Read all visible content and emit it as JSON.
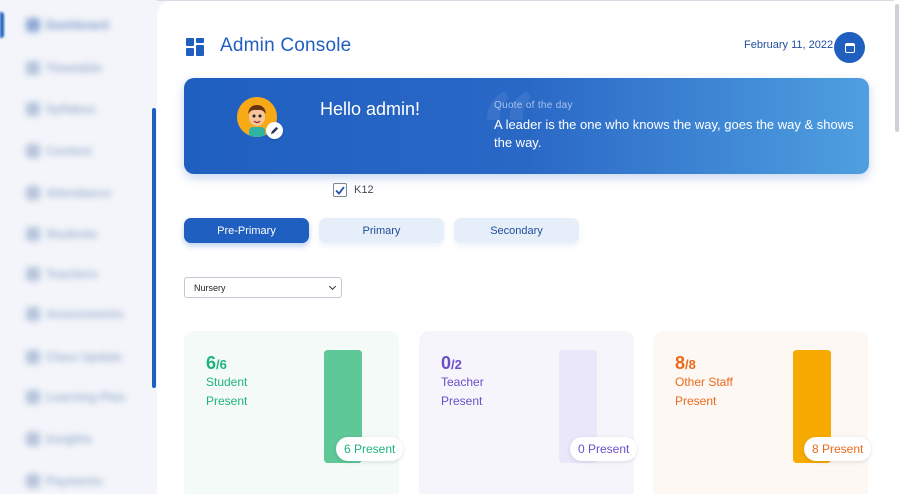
{
  "sidebar": {
    "items": [
      {
        "label": "Dashboard",
        "icon": "dashboard-icon"
      },
      {
        "label": "Timetable",
        "icon": "timetable-icon"
      },
      {
        "label": "Syllabus",
        "icon": "syllabus-icon"
      },
      {
        "label": "Content",
        "icon": "content-icon"
      },
      {
        "label": "Attendance",
        "icon": "attendance-icon"
      },
      {
        "label": "Students",
        "icon": "students-icon"
      },
      {
        "label": "Teachers",
        "icon": "teachers-icon"
      },
      {
        "label": "Assessments",
        "icon": "assessments-icon"
      },
      {
        "label": "Class Update",
        "icon": "class-update-icon"
      },
      {
        "label": "Learning Plan",
        "icon": "learning-plan-icon"
      },
      {
        "label": "Insights",
        "icon": "insights-icon"
      },
      {
        "label": "Payments",
        "icon": "payments-icon"
      }
    ]
  },
  "header": {
    "title": "Admin Console",
    "icon": "grid-icon",
    "date": "February 11, 2022",
    "calendar_icon": "calendar-icon"
  },
  "banner": {
    "greeting": "Hello admin!",
    "quote_label": "Quote of the day",
    "quote_text": "A leader is the one who knows the way, goes the way & shows the way.",
    "quote_glyph": "“",
    "avatar_icon": "user-avatar-icon",
    "edit_icon": "pencil-icon"
  },
  "k12": {
    "label": "K12",
    "checked": true
  },
  "tabs": [
    {
      "label": "Pre-Primary",
      "active": true
    },
    {
      "label": "Primary",
      "active": false
    },
    {
      "label": "Secondary",
      "active": false
    }
  ],
  "class_select": {
    "value": "Nursery"
  },
  "cards": [
    {
      "present": "6",
      "total": "/6",
      "role": "Student",
      "present_label": "Present",
      "pill": "6 Present",
      "ratio": 1.0,
      "color": "#1fb47a",
      "bar_color": "#5ec899",
      "track_color": "#5ec899",
      "bg": "#f4faf7"
    },
    {
      "present": "0",
      "total": "/2",
      "role": "Teacher",
      "present_label": "Present",
      "pill": "0 Present",
      "ratio": 0.0,
      "color": "#6a4fc9",
      "bar_color": "#ebe7fa",
      "track_color": "#ebe7fa",
      "bg": "#f6f5fc"
    },
    {
      "present": "8",
      "total": "/8",
      "role": "Other Staff",
      "present_label": "Present",
      "pill": "8 Present",
      "ratio": 1.0,
      "color": "#ea6a1c",
      "bar_color": "#f7ab00",
      "track_color": "#f7ab00",
      "bg": "#fef8f4"
    }
  ],
  "colors": {
    "brand": "#1f5fc0",
    "page_bg": "#ffffff"
  }
}
